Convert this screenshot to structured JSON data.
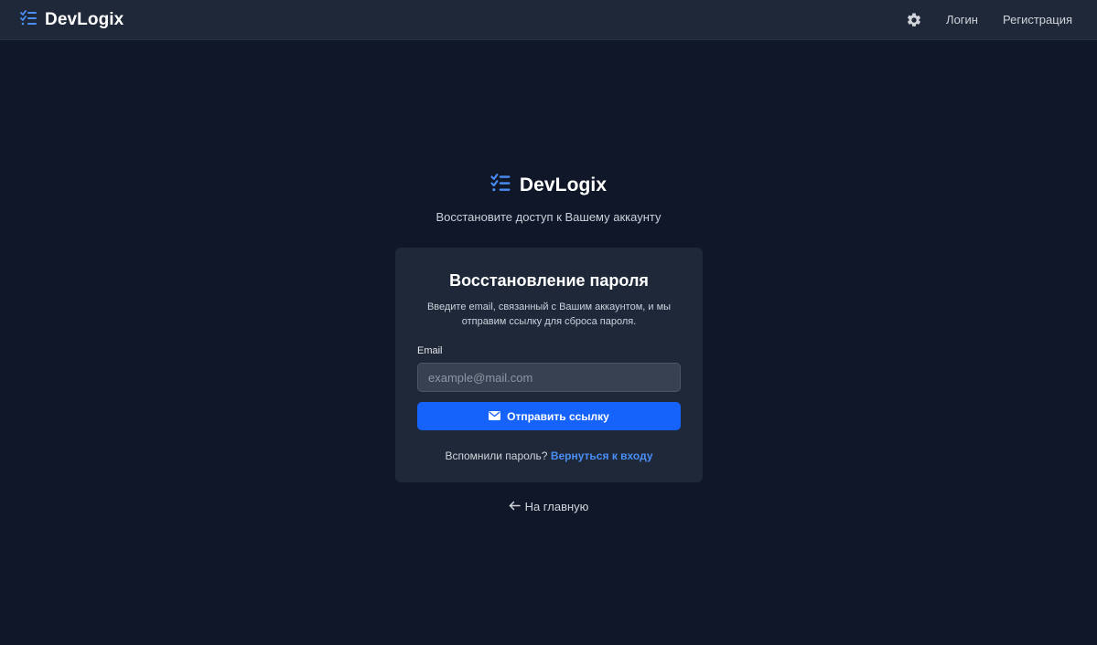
{
  "navbar": {
    "brand": "DevLogix",
    "login_label": "Логин",
    "register_label": "Регистрация"
  },
  "hero": {
    "brand": "DevLogix",
    "subtitle": "Восстановите доступ к Вашему аккаунту"
  },
  "card": {
    "title": "Восстановление пароля",
    "description": "Введите email, связанный с Вашим аккаунтом, и мы отправим ссылку для сброса пароля.",
    "email_label": "Email",
    "email_placeholder": "example@mail.com",
    "email_value": "",
    "submit_label": "Отправить ссылку",
    "remember_text": "Вспомнили пароль?",
    "back_to_login_label": "Вернуться к входу"
  },
  "footer": {
    "home_label": "На главную"
  },
  "icons": {
    "logo": "checklist-icon",
    "settings": "gear-icon",
    "mail": "envelope-icon",
    "back": "arrow-left-icon"
  },
  "colors": {
    "background": "#0f1728",
    "navbar": "#1e2839",
    "card": "#1e2839",
    "accent": "#1663fb",
    "link": "#4a8ef5",
    "logo_icon": "#4a8ef5"
  }
}
